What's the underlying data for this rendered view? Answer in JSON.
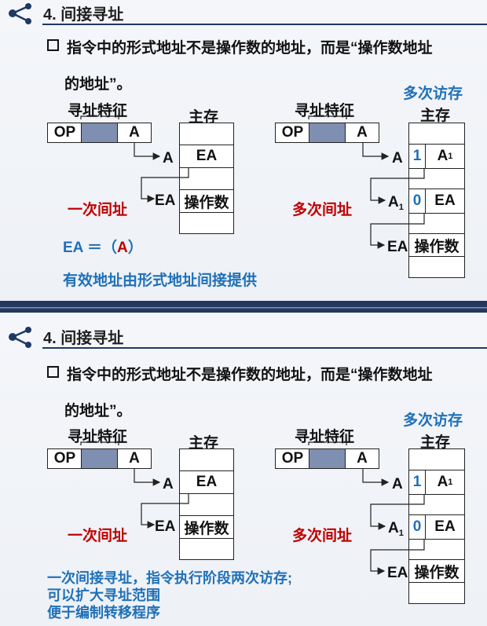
{
  "slide1": {
    "title": "4. 间接寻址",
    "bullet_line1": "指令中的形式地址不是操作数的地址，而是“操作数地址",
    "bullet_line2": "的地址”。",
    "left": {
      "addr_feature": "寻址特征",
      "op": "OP",
      "a": "A",
      "mem_title": "主存",
      "a_arrow": "A",
      "ea_cell": "EA",
      "ea_arrow": "EA",
      "operand_cell": "操作数",
      "indirect_label": "一次间址",
      "formula_ea": "EA ＝（",
      "formula_a": "A",
      "formula_close": "）",
      "note": "有效地址由形式地址间接提供"
    },
    "right": {
      "multi_access": "多次访存",
      "mem_title": "主存",
      "addr_feature": "寻址特征",
      "op": "OP",
      "a": "A",
      "a_arrow": "A",
      "bit1": "1",
      "a1_cell": "A",
      "a1_sub": "1",
      "a1_arrow": "A",
      "a1_arrow_sub": "1",
      "bit0": "0",
      "ea_cell": "EA",
      "ea_arrow": "EA",
      "operand_cell": "操作数",
      "multi_indirect_label": "多次间址"
    }
  },
  "slide2": {
    "title": "4. 间接寻址",
    "bullet_line1": "指令中的形式地址不是操作数的地址，而是“操作数地址",
    "bullet_line2": "的地址”。",
    "left": {
      "addr_feature": "寻址特征",
      "op": "OP",
      "a": "A",
      "mem_title": "主存",
      "a_arrow": "A",
      "ea_cell": "EA",
      "ea_arrow": "EA",
      "operand_cell": "操作数",
      "indirect_label": "一次间址"
    },
    "right": {
      "multi_access": "多次访存",
      "mem_title": "主存",
      "addr_feature": "寻址特征",
      "op": "OP",
      "a": "A",
      "a_arrow": "A",
      "bit1": "1",
      "a1_cell": "A",
      "a1_sub": "1",
      "a1_arrow": "A",
      "a1_arrow_sub": "1",
      "bit0": "0",
      "ea_cell": "EA",
      "ea_arrow": "EA",
      "operand_cell": "操作数",
      "multi_indirect_label": "多次间址"
    },
    "notes": [
      "一次间接寻址，指令执行阶段两次访存;",
      "可以扩大寻址范围",
      "便于编制转移程序"
    ]
  },
  "colors": {
    "accent_blue": "#1f70b8",
    "accent_red": "#c00000",
    "header_navy": "#1f3864",
    "gray_cell": "#7f8fb2"
  }
}
